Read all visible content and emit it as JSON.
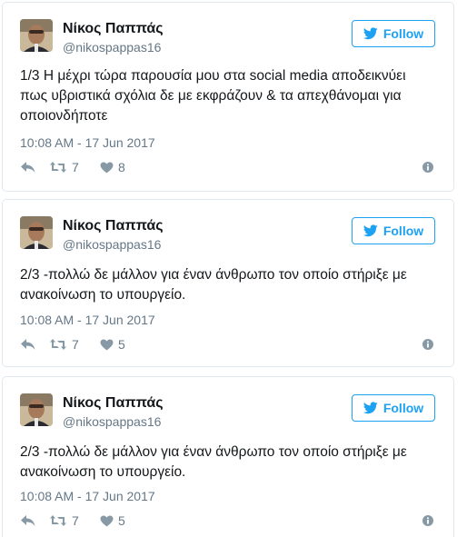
{
  "tweets": [
    {
      "name": "Νίκος Παππάς",
      "handle": "@nikospappas16",
      "follow_label": "Follow",
      "text": "1/3 Η μέχρι τώρα παρουσία μου στα social media αποδεικνύει πως υβριστικά σχόλια δε με εκφράζουν & τα απεχθάνομαι για οποιονδήποτε",
      "timestamp": "10:08 AM - 17 Jun 2017",
      "retweets": "7",
      "likes": "8"
    },
    {
      "name": "Νίκος Παππάς",
      "handle": "@nikospappas16",
      "follow_label": "Follow",
      "text": "2/3 -πολλώ δε μάλλον για έναν άνθρωπο τον οποίο στήριξε με ανακοίνωση το υπουργείο.",
      "timestamp": "10:08 AM - 17 Jun 2017",
      "retweets": "7",
      "likes": "5"
    },
    {
      "name": "Νίκος Παππάς",
      "handle": "@nikospappas16",
      "follow_label": "Follow",
      "text": "2/3 -πολλώ δε μάλλον για έναν άνθρωπο τον οποίο στήριξε με ανακοίνωση το υπουργείο.",
      "timestamp": "10:08 AM - 17 Jun 2017",
      "retweets": "7",
      "likes": "5"
    }
  ],
  "icons": {
    "bird": "twitter-bird-icon",
    "reply": "reply-icon",
    "retweet": "retweet-icon",
    "like": "heart-icon",
    "info": "info-icon"
  },
  "colors": {
    "accent": "#1da1f2",
    "muted": "#657786",
    "text": "#14171a",
    "border": "#e1e8ed"
  }
}
